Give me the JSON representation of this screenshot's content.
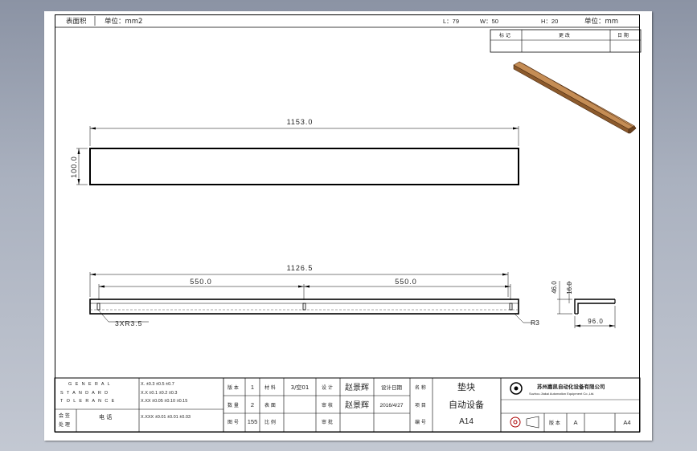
{
  "header": {
    "area_label": "表面积",
    "area_unit_label": "单位：mm2",
    "l_label": "L：79",
    "w_label": "W：50",
    "h_label": "H：20",
    "unit_label": "单位：mm"
  },
  "revision_table": {
    "col1": "标 记",
    "col2": "更 改",
    "col3": "日 期"
  },
  "views": {
    "top": {
      "dim_length": "1153.0",
      "dim_width": "100.0"
    },
    "front": {
      "dim_total": "1126.5",
      "dim_left": "550.0",
      "dim_right": "550.0",
      "holes_callout": "3XR3.5",
      "radius_callout": "R3"
    },
    "side": {
      "dim_height": "46.0",
      "dim_inner": "16.0",
      "dim_width": "96.0"
    }
  },
  "title_block": {
    "tolerance_rows": [
      "X.    ±0.3  ±0.5  ±0.7",
      "X.X   ±0.1  ±0.2  ±0.3",
      "X.XX  ±0.05 ±0.10 ±0.15",
      "X.XXX ±0.01 ±0.01 ±0.03"
    ],
    "left_labels": [
      "会 签",
      "处 理"
    ],
    "left_value": "电 话",
    "version_labels": [
      "版 本",
      "数 量",
      "图 号"
    ],
    "version_values": [
      "1",
      "2",
      "155"
    ],
    "row_labels_a": [
      "材 料",
      "表 面",
      "比 例"
    ],
    "row_values_a": [
      "3/空01",
      "",
      ""
    ],
    "designer_labels": [
      "设 计",
      "审 核",
      "审 批"
    ],
    "designer_name": "赵景辉",
    "checker_name": "赵景辉",
    "date_label": "设计日期",
    "date_value": "2016/4/27",
    "name_label": "名 称",
    "name_value": "垫块",
    "project_label": "项 目",
    "project_value": "自动设备",
    "code_label": "编 号",
    "code_value": "A14",
    "company_cn": "苏州嘉凯自动化设备有限公司",
    "company_en": "Suzhou Jiakai Automation Equipment Co.,Ltd.",
    "sheet_label": "版 本",
    "sheet_rev": "A",
    "paper_size": "A4"
  }
}
